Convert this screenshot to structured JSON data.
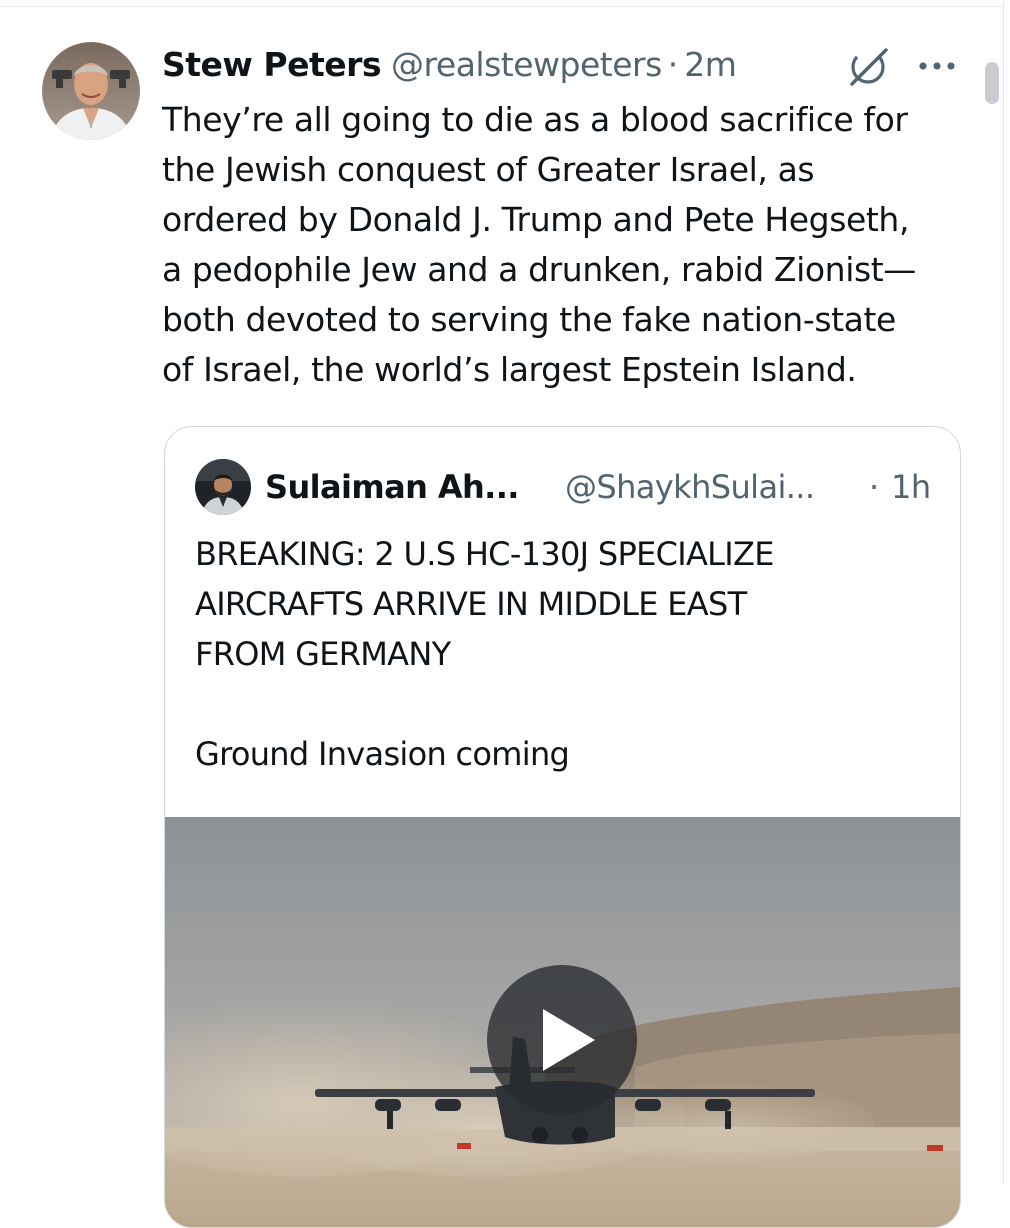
{
  "tweet": {
    "display_name": "Stew Peters",
    "handle": "@realstewpeters",
    "separator": "·",
    "time": "2m",
    "text": "They’re all going to die as a blood sacrifice for\nthe Jewish conquest of Greater Israel, as\nordered by Donald J. Trump and Pete Hegseth,\na pedophile Jew and a drunken, rabid Zionist—\nboth devoted to serving the fake nation-state\nof Israel, the world’s largest Epstein Island.",
    "icons": {
      "grok": "grok-icon",
      "more": "more-icon",
      "avatar": "avatar"
    }
  },
  "quote": {
    "display_name": "Sulaiman Ah...",
    "handle": "@ShaykhSulai...",
    "separator": "·",
    "time": "1h",
    "text_lines": [
      "BREAKING: 2 U.S HC-130J SPECIALIZE",
      "AIRCRAFTS ARRIVE IN MIDDLE EAST",
      "FROM GERMANY"
    ],
    "text_secondary": "Ground Invasion coming",
    "media": {
      "kind": "video",
      "play_icon": "play-icon"
    }
  },
  "colors": {
    "text_primary": "#0f1419",
    "text_secondary": "#536471",
    "border": "#cfd9de"
  }
}
